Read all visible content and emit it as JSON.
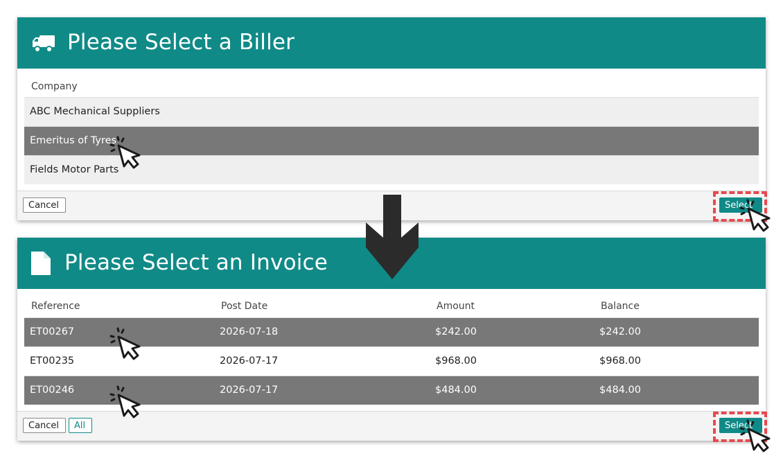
{
  "biller_dialog": {
    "title": "Please Select a Biller",
    "header_icon": "truck-icon",
    "column_header": "Company",
    "rows": [
      {
        "company": "ABC Mechanical Suppliers",
        "selected": false
      },
      {
        "company": "Emeritus of Tyres",
        "selected": true
      },
      {
        "company": "Fields Motor Parts",
        "selected": false
      }
    ],
    "cancel_label": "Cancel",
    "select_label": "Select"
  },
  "invoice_dialog": {
    "title": "Please Select an Invoice",
    "header_icon": "document-icon",
    "columns": [
      "Reference",
      "Post Date",
      "Amount",
      "Balance"
    ],
    "rows": [
      {
        "reference": "ET00267",
        "post_date": "2026-07-18",
        "amount": "$242.00",
        "balance": "$242.00",
        "selected": true
      },
      {
        "reference": "ET00235",
        "post_date": "2026-07-17",
        "amount": "$968.00",
        "balance": "$968.00",
        "selected": false
      },
      {
        "reference": "ET00246",
        "post_date": "2026-07-17",
        "amount": "$484.00",
        "balance": "$484.00",
        "selected": true
      }
    ],
    "cancel_label": "Cancel",
    "all_label": "All",
    "select_label": "Select"
  },
  "colors": {
    "header_teal": "#108a87",
    "selected_row": "#787878",
    "highlight_red": "#e8494f"
  },
  "annotations": {
    "flow_arrow": "down-arrow-icon",
    "click_cursor": "click-cursor-icon"
  }
}
